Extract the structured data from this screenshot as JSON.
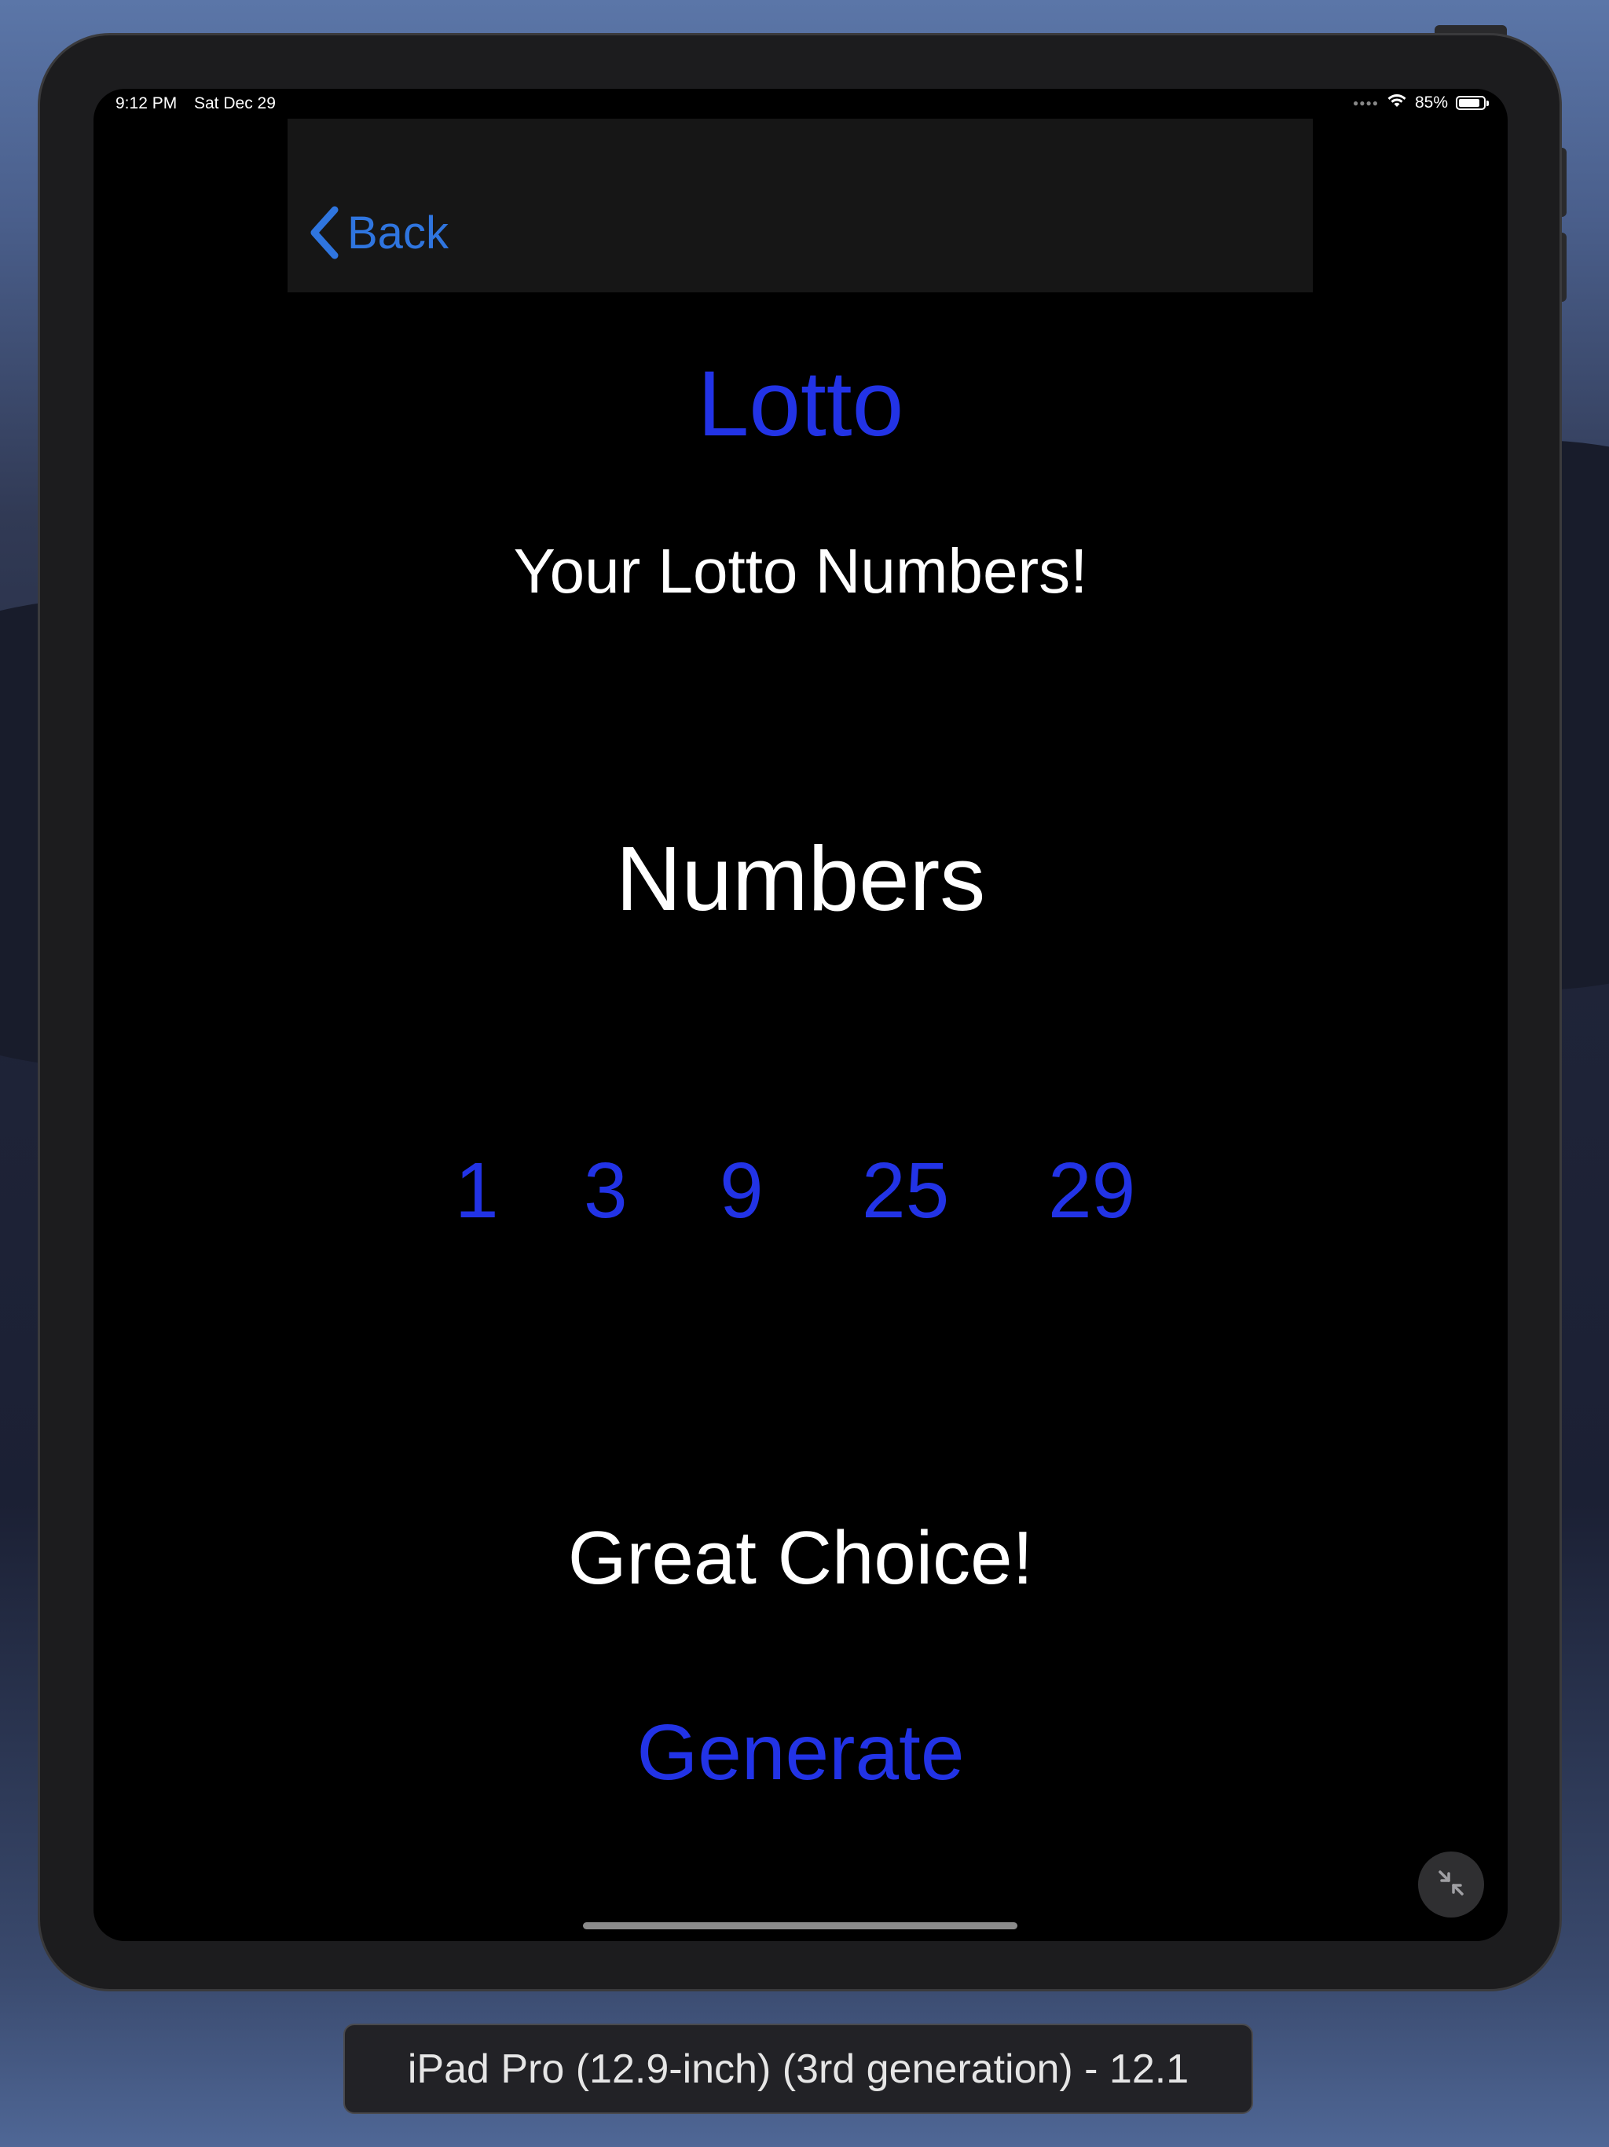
{
  "status_bar": {
    "time": "9:12 PM",
    "date": "Sat Dec 29",
    "battery": "85%",
    "battery_level": 0.85,
    "wifi_icon": "wifi-icon",
    "signal_icon": "signal-dots-icon"
  },
  "nav": {
    "back_label": "Back",
    "back_icon": "chevron-left-icon"
  },
  "screen": {
    "title": "Lotto",
    "subtitle": "Your Lotto Numbers!",
    "numbers_heading": "Numbers",
    "numbers": [
      "1",
      "3",
      "9",
      "25",
      "29"
    ],
    "message": "Great Choice!",
    "generate_label": "Generate"
  },
  "simulator": {
    "device_label": "iPad Pro (12.9-inch) (3rd generation) - 12.1",
    "minimize_icon": "minimize-arrows-icon"
  },
  "colors": {
    "accent_blue": "#2233e6",
    "back_blue": "#2f75df",
    "text_white": "#ffffff",
    "screen_bg": "#000000",
    "nav_bg": "#161616"
  }
}
